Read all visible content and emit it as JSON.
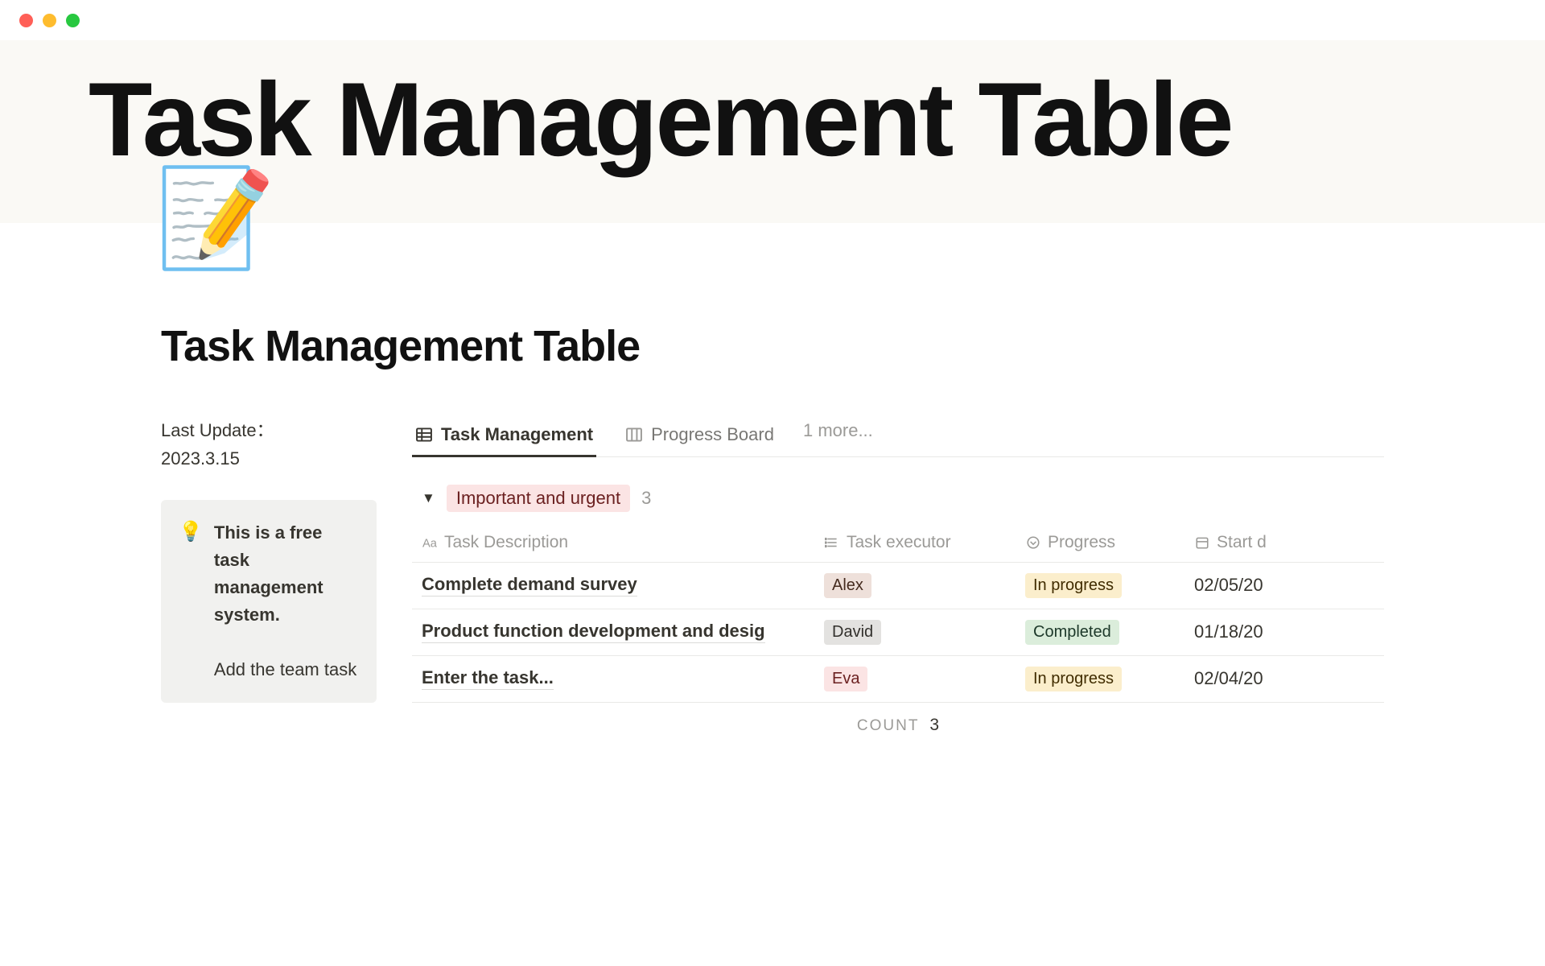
{
  "hero": {
    "title": "Task Management Table"
  },
  "page": {
    "icon": "📝",
    "title": "Task Management Table"
  },
  "sidebar": {
    "last_update_label": "Last Update：",
    "last_update_value": "2023.3.15",
    "callout_icon": "💡",
    "callout_bold": "This is a free task management system.",
    "callout_rest": "Add the team task"
  },
  "tabs": {
    "items": [
      {
        "icon": "table",
        "label": "Task Management",
        "active": true
      },
      {
        "icon": "board",
        "label": "Progress Board",
        "active": false
      }
    ],
    "more_label": "1 more..."
  },
  "group": {
    "label": "Important and urgent",
    "count": "3"
  },
  "columns": {
    "desc": "Task Description",
    "exec": "Task executor",
    "prog": "Progress",
    "start": "Start d"
  },
  "rows": [
    {
      "desc": "Complete demand survey",
      "exec": "Alex",
      "exec_color": "brown",
      "prog": "In progress",
      "prog_color": "yellow",
      "start": "02/05/20"
    },
    {
      "desc": "Product function development and desig",
      "exec": "David",
      "exec_color": "gray",
      "prog": "Completed",
      "prog_color": "green",
      "start": "01/18/20"
    },
    {
      "desc": "Enter the task...",
      "exec": "Eva",
      "exec_color": "red",
      "prog": "In progress",
      "prog_color": "yellow",
      "start": "02/04/20"
    }
  ],
  "footer": {
    "count_label": "COUNT",
    "count_value": "3"
  }
}
